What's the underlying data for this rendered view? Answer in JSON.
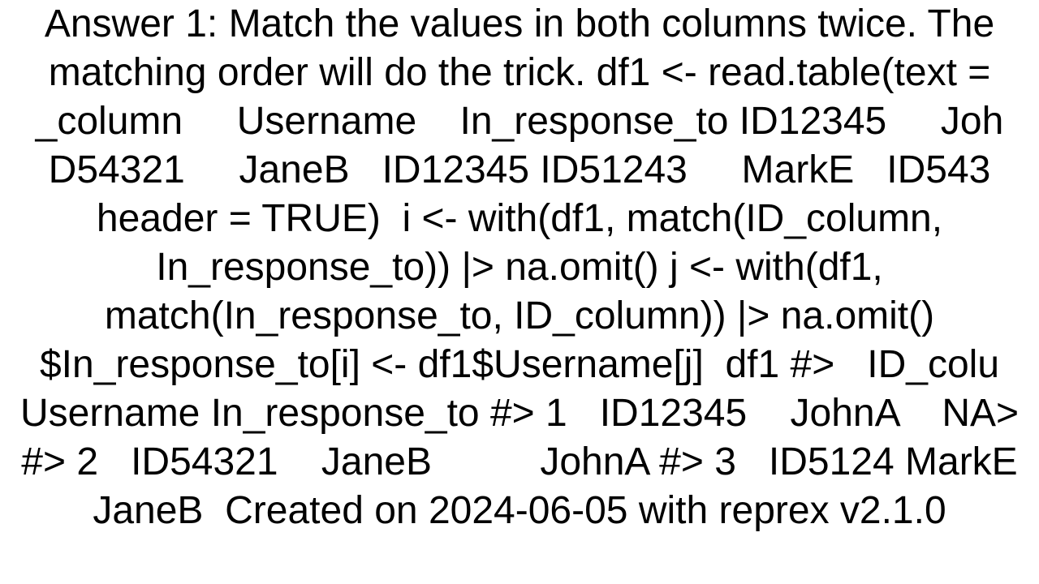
{
  "document": {
    "text": "Answer 1: Match the values in both columns twice. The matching order will do the trick. df1 <- read.table(text = _column     Username    In_response_to ID12345     Joh D54321     JaneB   ID12345 ID51243     MarkE   ID543 header = TRUE)  i <- with(df1, match(ID_column, In_response_to)) |> na.omit() j <- with(df1, match(In_response_to, ID_column)) |> na.omit() $In_response_to[i] <- df1$Username[j]  df1 #>   ID_colu Username In_response_to #> 1   ID12345    JohnA    NA> #> 2   ID54321    JaneB          JohnA #> 3   ID5124 MarkE          JaneB  Created on 2024-06-05 with reprex v2.1.0"
  }
}
